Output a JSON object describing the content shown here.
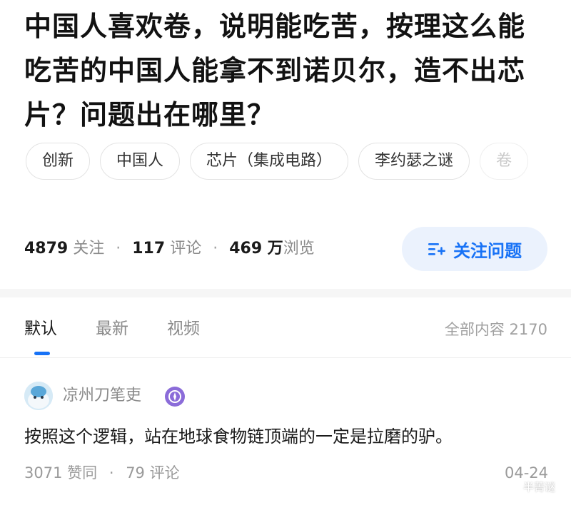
{
  "question": {
    "title": "中国人喜欢卷，说明能吃苦，按理这么能吃苦的中国人能拿不到诺贝尔，造不出芯片？问题出在哪里？",
    "topics": [
      "创新",
      "中国人",
      "芯片（集成电路）",
      "李约瑟之谜",
      "卷"
    ],
    "stats": {
      "followers": "4879",
      "followers_label": "关注",
      "comments": "117",
      "comments_label": "评论",
      "views": "469 万",
      "views_label": "浏览",
      "separator": "·"
    },
    "follow_button": "关注问题",
    "follow_icon": "add-list-icon"
  },
  "tabs": {
    "items": [
      "默认",
      "最新",
      "视频"
    ],
    "active": "默认",
    "total_label": "全部内容 2170"
  },
  "answer": {
    "author": "凉州刀笔吏",
    "badge_icon": "compass-badge-icon",
    "content": "按照这个逻辑，站在地球食物链顶端的一定是拉磨的驴。",
    "likes": "3071 赞同",
    "separator": "·",
    "comments": "79 评论",
    "date": "04-24"
  },
  "colors": {
    "accent": "#1772f6",
    "accent_bg": "#ebf2fd",
    "muted": "#8a8a8a",
    "badge": "#8b6cd9"
  },
  "watermark": "半菁谜"
}
